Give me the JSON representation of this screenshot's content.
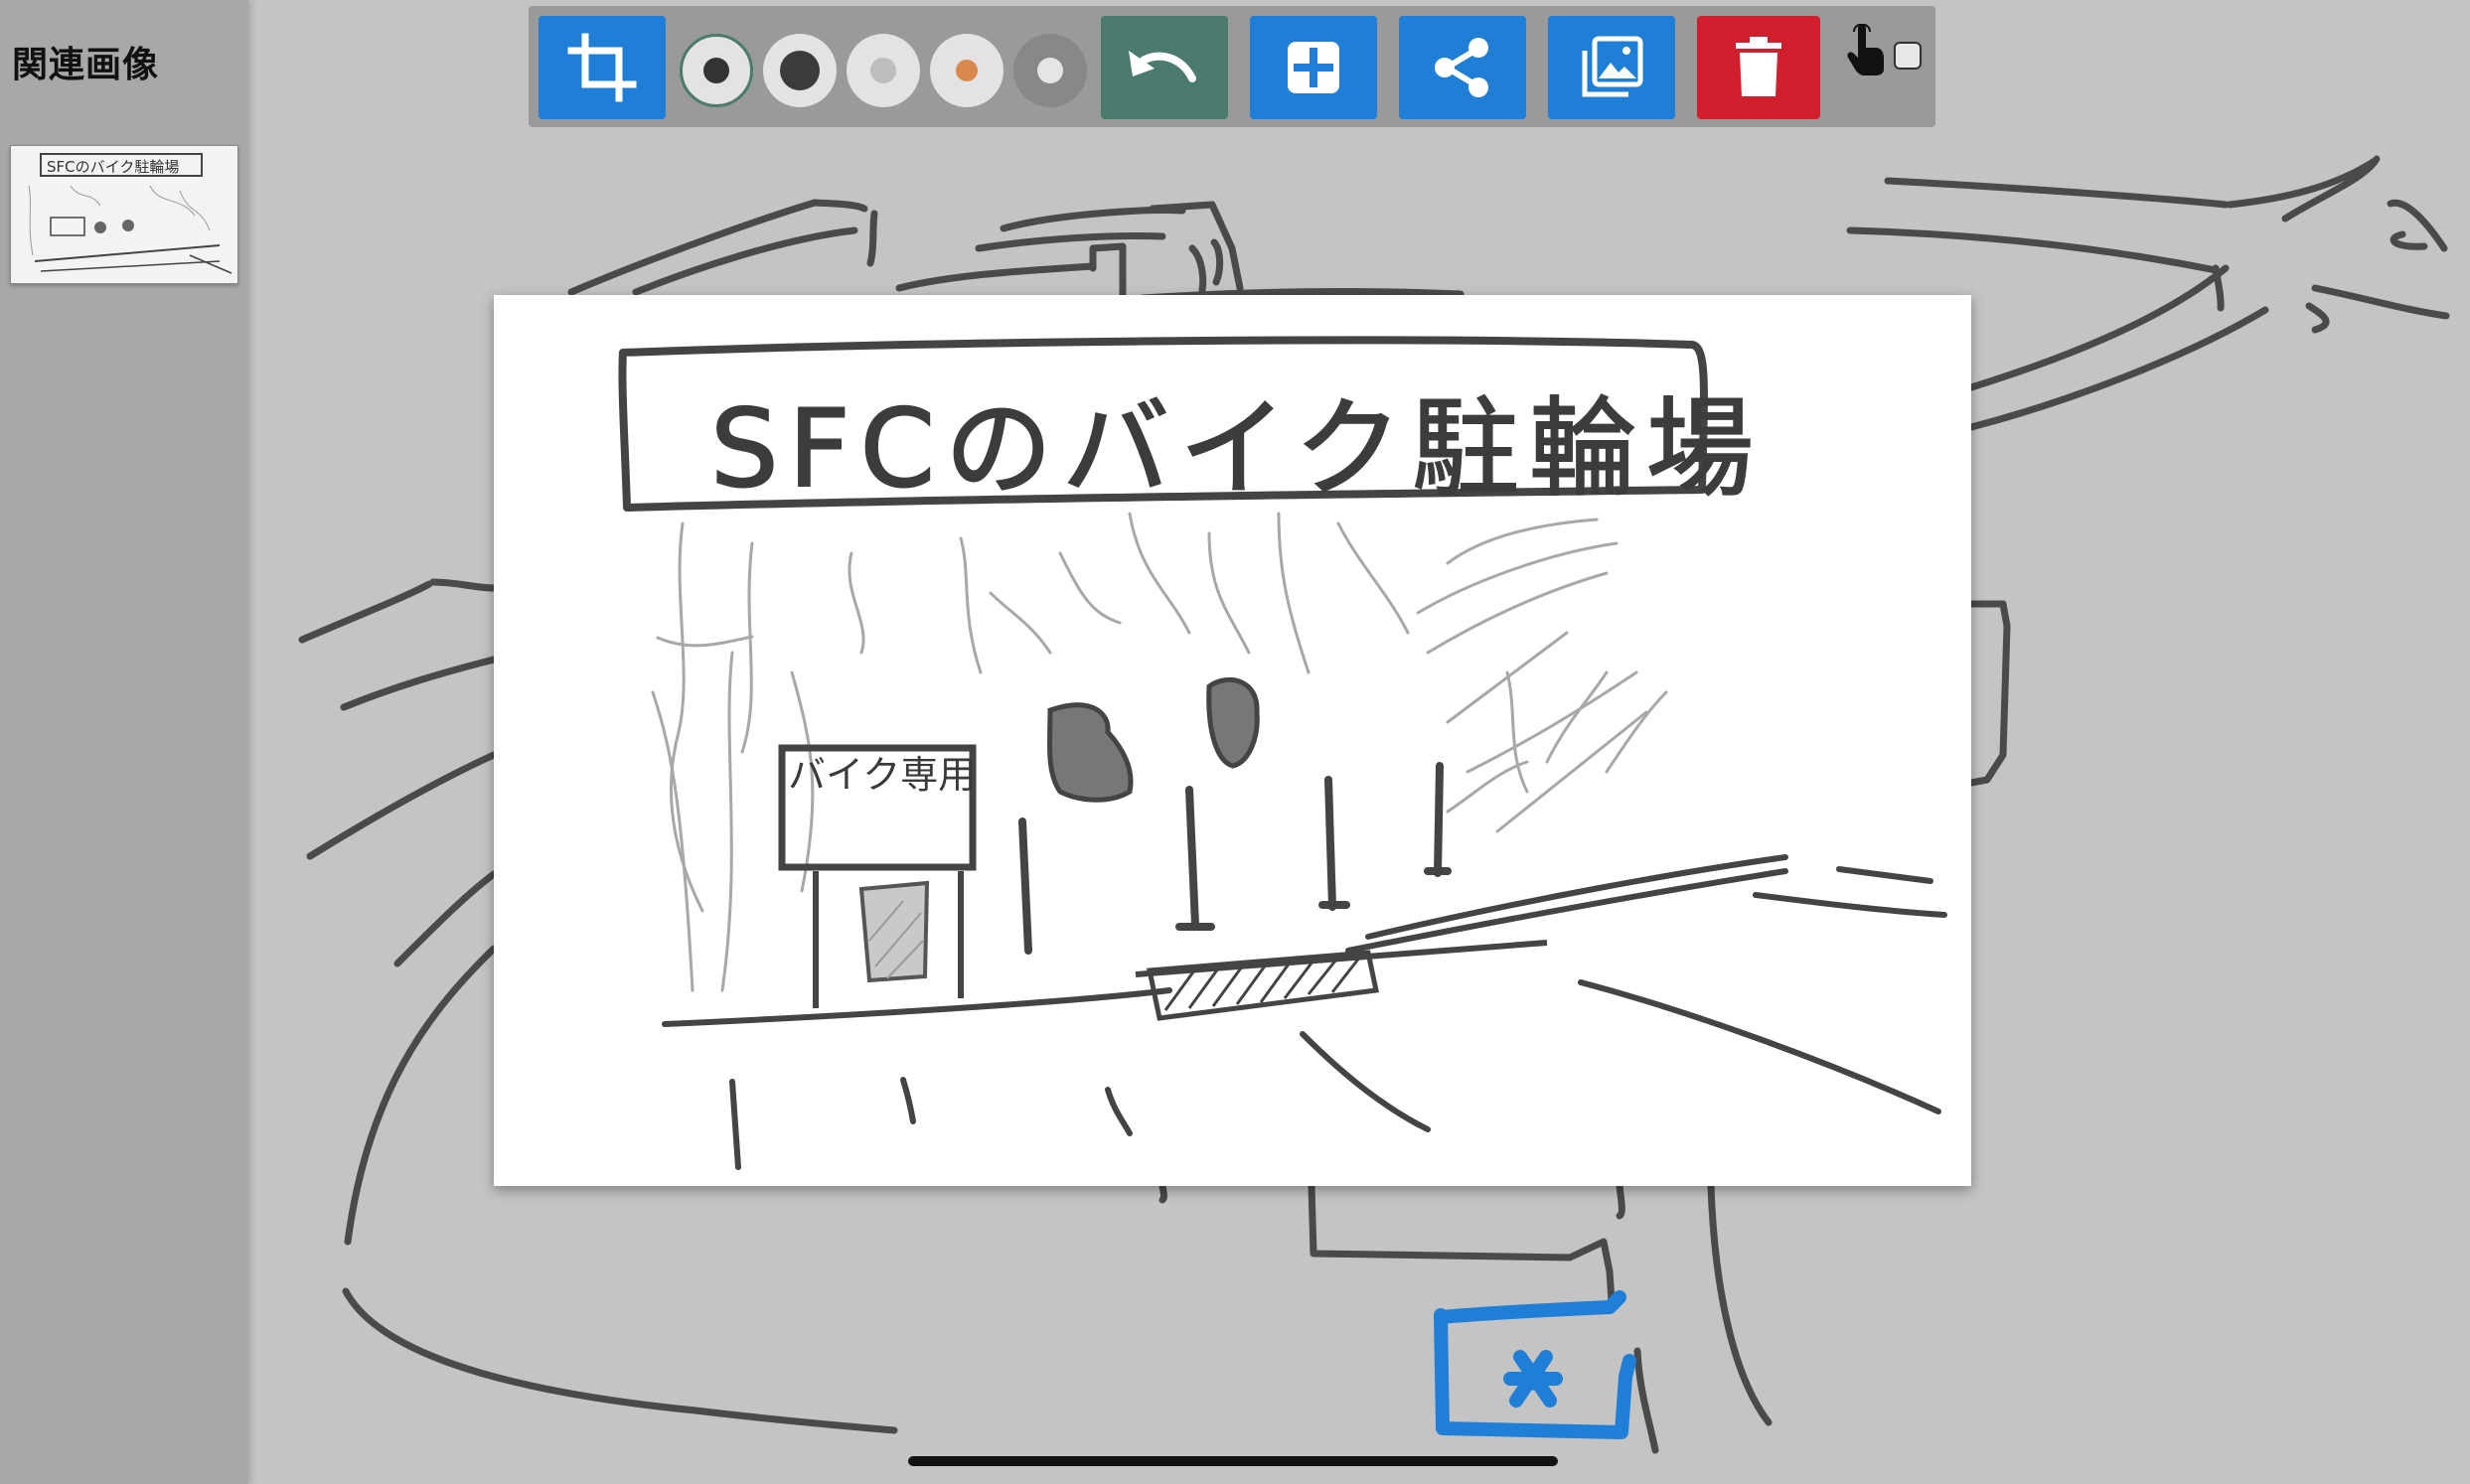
{
  "sidebar": {
    "title": "関連画像",
    "thumbnail_title": "SFCのバイク駐輪場"
  },
  "toolbar": {
    "buttons": [
      {
        "name": "crop",
        "icon": "crop-icon",
        "color": "#1f7fd6"
      },
      {
        "name": "pen-size-selected",
        "icon": "dot-ring-icon"
      },
      {
        "name": "pen-black",
        "icon": "dot-icon",
        "color": "#3b3b3b"
      },
      {
        "name": "pen-light",
        "icon": "dot-icon",
        "color": "#bdbdbd"
      },
      {
        "name": "pen-orange",
        "icon": "dot-icon",
        "color": "#d9894e"
      },
      {
        "name": "pen-gray",
        "icon": "dot-icon",
        "color": "#888888"
      },
      {
        "name": "undo",
        "icon": "undo-icon",
        "color": "#4b7a6e"
      },
      {
        "name": "add",
        "icon": "plus-icon",
        "color": "#1f7fd6"
      },
      {
        "name": "share",
        "icon": "share-icon",
        "color": "#1f7fd6"
      },
      {
        "name": "gallery",
        "icon": "gallery-icon",
        "color": "#1f7fd6"
      },
      {
        "name": "delete",
        "icon": "trash-icon",
        "color": "#d0202e"
      }
    ],
    "touch_mode": {
      "icon": "hand-pointer-icon",
      "checked": false
    }
  },
  "card": {
    "title": "SFCのバイク駐輪場",
    "sign_label": "バイク専用"
  },
  "colors": {
    "background": "#c4c4c4",
    "stroke": "#4a4a4a",
    "marker_blue": "#1f7fd6",
    "accent_red": "#d0202e"
  }
}
